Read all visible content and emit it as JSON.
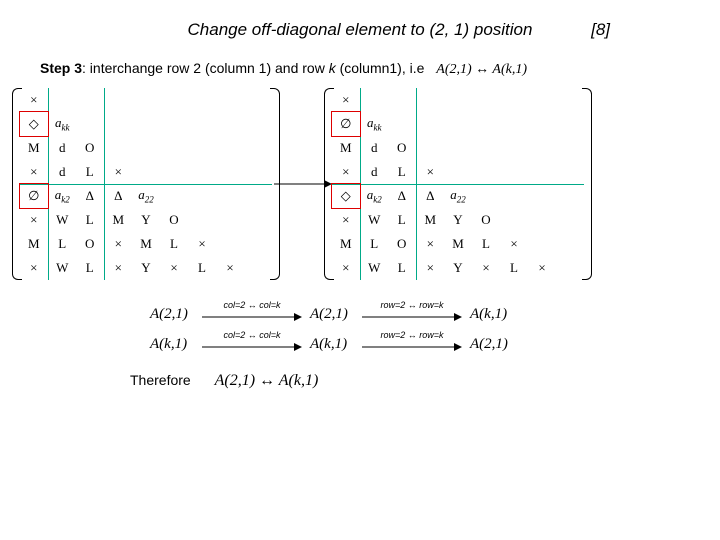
{
  "title": "Change off-diagonal element to (2, 1) position",
  "slide_number": "[8]",
  "step_label": "Step 3",
  "step_text_pre": ": interchange row 2 (column 1) and row ",
  "step_k": "k",
  "step_text_post": " (column1), i.e",
  "step_eq": "A(2,1) ↔ A(k,1)",
  "sym": {
    "x": "×",
    "diamond": "◇",
    "empty": "∅",
    "Delta": "Δ"
  },
  "matrixA": {
    "r1": [
      "×",
      "",
      "",
      "",
      "",
      "",
      "",
      "",
      ""
    ],
    "r2": [
      "◇",
      "a_kk",
      "",
      "",
      "",
      "",
      "",
      "",
      ""
    ],
    "r3": [
      "M",
      "d",
      "O",
      "",
      "",
      "",
      "",
      "",
      ""
    ],
    "r4": [
      "×",
      "d",
      "L",
      "×",
      "",
      "",
      "",
      "",
      ""
    ],
    "r5": [
      "∅",
      "a_k2",
      "Δ",
      "Δ",
      "a_22",
      "",
      "",
      "",
      ""
    ],
    "r6": [
      "×",
      "W",
      "L",
      "M",
      "Y",
      "O",
      "",
      "",
      ""
    ],
    "r7": [
      "M",
      "L",
      "O",
      "×",
      "M",
      "L",
      "×",
      "",
      ""
    ],
    "r8": [
      "×",
      "W",
      "L",
      "×",
      "Y",
      "×",
      "L",
      "×",
      ""
    ]
  },
  "matrixB": {
    "r1": [
      "×",
      "",
      "",
      "",
      "",
      "",
      "",
      "",
      ""
    ],
    "r2": [
      "∅",
      "a_kk",
      "",
      "",
      "",
      "",
      "",
      "",
      ""
    ],
    "r3": [
      "M",
      "d",
      "O",
      "",
      "",
      "",
      "",
      "",
      ""
    ],
    "r4": [
      "×",
      "d",
      "L",
      "×",
      "",
      "",
      "",
      "",
      ""
    ],
    "r5": [
      "◇",
      "a_k2",
      "Δ",
      "Δ",
      "a_22",
      "",
      "",
      "",
      ""
    ],
    "r6": [
      "×",
      "W",
      "L",
      "M",
      "Y",
      "O",
      "",
      "",
      ""
    ],
    "r7": [
      "M",
      "L",
      "O",
      "×",
      "M",
      "L",
      "×",
      "",
      ""
    ],
    "r8": [
      "×",
      "W",
      "L",
      "×",
      "Y",
      "×",
      "L",
      "×",
      ""
    ]
  },
  "deriv": {
    "row1": {
      "n1": "A(2,1)",
      "l1": "col=2 ↔ col=k",
      "n2": "A(2,1)",
      "l2": "row=2 ↔ row=k",
      "n3": "A(k,1)"
    },
    "row2": {
      "n1": "A(k,1)",
      "l1": "col=2 ↔ col=k",
      "n2": "A(k,1)",
      "l2": "row=2 ↔ row=k",
      "n3": "A(2,1)"
    }
  },
  "therefore_label": "Therefore",
  "therefore_eq": "A(2,1) ↔ A(k,1)"
}
